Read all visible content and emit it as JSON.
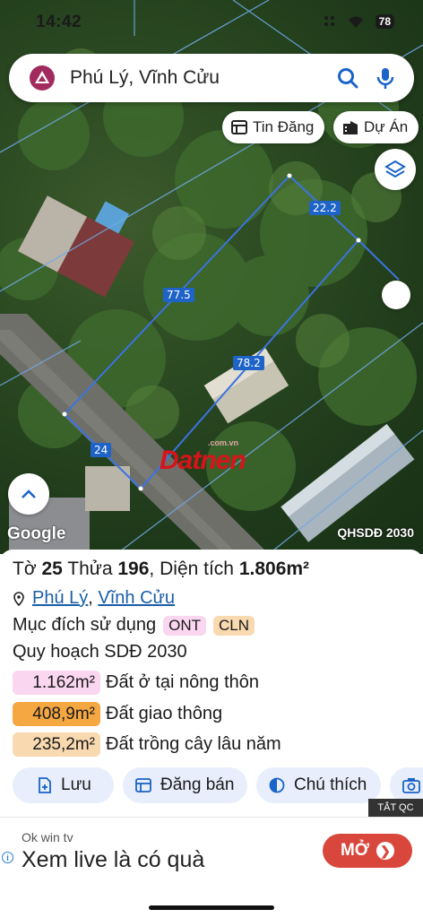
{
  "status": {
    "time": "14:42",
    "battery": "78"
  },
  "search": {
    "value": "Phú Lý, Vĩnh Cửu"
  },
  "pills": {
    "listings": "Tin Đăng",
    "projects": "Dự Án"
  },
  "map": {
    "dimensions": [
      "22.2",
      "77.5",
      "78.2",
      "24"
    ],
    "watermark": "Datnen",
    "watermark_small": ".com.vn",
    "attribution": "Google",
    "layer_label": "QHSDĐ 2030"
  },
  "parcel": {
    "title_prefix": "Tờ",
    "sheet_no": "25",
    "plot_label": "Thửa",
    "plot_no": "196",
    "area_label": "Diện tích",
    "area_value": "1.806m²",
    "location_ward": "Phú Lý",
    "location_district": "Vĩnh Cửu",
    "purpose_label": "Mục đích sử dụng",
    "tags": [
      "ONT",
      "CLN"
    ],
    "plan_label": "Quy hoạch SDĐ 2030",
    "areas": [
      {
        "value": "1.162m²",
        "label": "Đất ở tại nông thôn",
        "color": "#fad6f0"
      },
      {
        "value": "408,9m²",
        "label": "Đất giao thông",
        "color": "#f5a742"
      },
      {
        "value": "235,2m²",
        "label": "Đất trồng cây lâu năm",
        "color": "#f8d9b0"
      }
    ]
  },
  "actions": {
    "save": "Lưu",
    "post": "Đăng bán",
    "legend": "Chú thích"
  },
  "ad": {
    "close_label": "TẮT QC",
    "sub": "Ok win tv",
    "main": "Xem live là có quà",
    "button": "MỞ"
  },
  "colors": {
    "accent": "#1a5ea8",
    "parcel_line": "#3b73e0",
    "ad_button": "#d8463c"
  }
}
